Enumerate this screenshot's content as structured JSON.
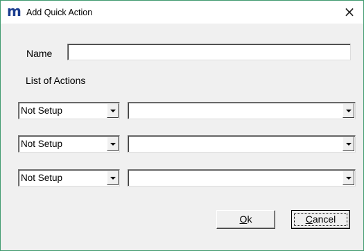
{
  "window": {
    "app_icon": "m",
    "title": "Add Quick Action",
    "close_glyph": "×"
  },
  "form": {
    "name_label": "Name",
    "name_value": "",
    "list_label": "List of Actions",
    "actions": [
      {
        "type": "Not Setup",
        "detail": ""
      },
      {
        "type": "Not Setup",
        "detail": ""
      },
      {
        "type": "Not Setup",
        "detail": ""
      }
    ]
  },
  "buttons": {
    "ok_mnemonic": "O",
    "ok_rest": "k",
    "cancel_mnemonic": "C",
    "cancel_rest": "ancel"
  }
}
